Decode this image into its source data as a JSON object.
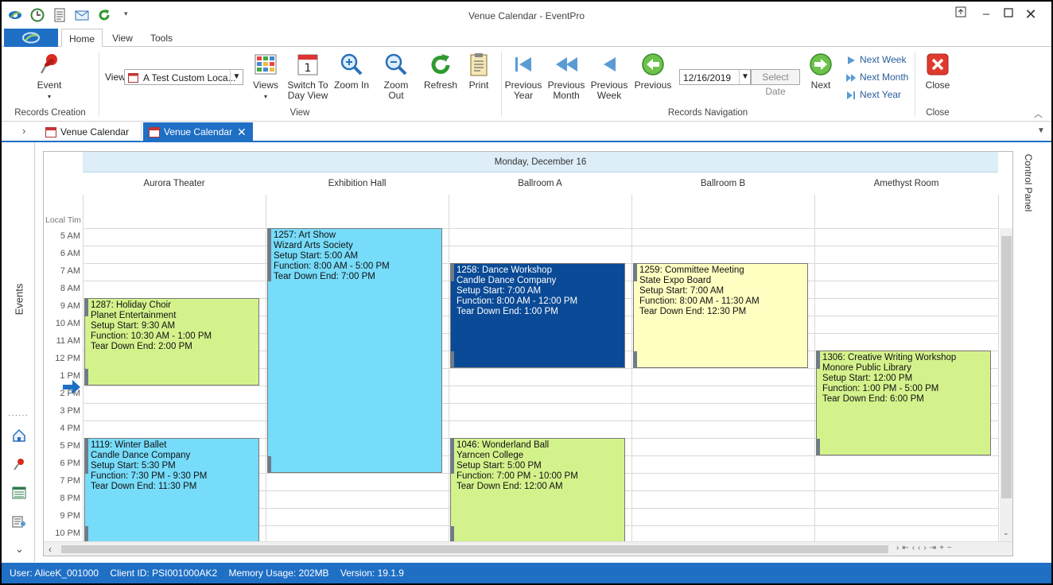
{
  "window": {
    "title": "Venue Calendar - EventPro"
  },
  "ribbon_tabs": [
    "Home",
    "View",
    "Tools"
  ],
  "ribbon": {
    "event": "Event",
    "view_label": "View",
    "view_select": "A Test Custom Loca...",
    "views": "Views",
    "switch_day_1": "Switch To",
    "switch_day_2": "Day View",
    "zoom_in": "Zoom In",
    "zoom_out": "Zoom Out",
    "refresh": "Refresh",
    "print": "Print",
    "prev_year_1": "Previous",
    "prev_year_2": "Year",
    "prev_month_1": "Previous",
    "prev_month_2": "Month",
    "prev_week_1": "Previous",
    "prev_week_2": "Week",
    "previous": "Previous",
    "date": "12/16/2019",
    "select_date": "Select Date",
    "next": "Next",
    "next_week": "Next Week",
    "next_month": "Next Month",
    "next_year": "Next Year",
    "close": "Close",
    "groups": {
      "records_creation": "Records Creation",
      "view": "View",
      "records_navigation": "Records Navigation",
      "close": "Close"
    }
  },
  "doc_tabs": [
    "Venue Calendar",
    "Venue Calendar"
  ],
  "left_panel": {
    "label": "Events"
  },
  "right_panel": {
    "label": "Control Panel"
  },
  "calendar": {
    "date_header": "Monday, December 16",
    "time_header": "Local Tim",
    "rooms": [
      "Aurora Theater",
      "Exhibition Hall",
      "Ballroom A",
      "Ballroom B",
      "Amethyst Room"
    ],
    "times": [
      "5 AM",
      "6 AM",
      "7 AM",
      "8 AM",
      "9 AM",
      "10 AM",
      "11 AM",
      "12 PM",
      "1 PM",
      "2 PM",
      "3 PM",
      "4 PM",
      "5 PM",
      "6 PM",
      "7 PM",
      "8 PM",
      "9 PM",
      "10 PM"
    ],
    "events": [
      {
        "lines": [
          "1287: Holiday Choir",
          "Planet Entertainment",
          "Setup Start: 9:30 AM",
          "Function: 10:30 AM - 1:00 PM",
          "Tear Down End: 2:00 PM"
        ],
        "color": "#d4f28c"
      },
      {
        "lines": [
          "1257: Art Show",
          "Wizard Arts Society",
          "Setup Start: 5:00 AM",
          "Function: 8:00 AM - 5:00 PM",
          "Tear Down End: 7:00 PM"
        ],
        "color": "#77dcfa"
      },
      {
        "lines": [
          "1258: Dance Workshop",
          "Candle Dance Company",
          "Setup Start: 7:00 AM",
          "Function: 8:00 AM - 12:00 PM",
          "Tear Down End: 1:00 PM"
        ],
        "color": "#0a4a96"
      },
      {
        "lines": [
          "1259: Committee Meeting",
          "State Expo Board",
          "Setup Start: 7:00 AM",
          "Function: 8:00 AM - 11:30 AM",
          "Tear Down End: 12:30 PM"
        ],
        "color": "#ffffc2"
      },
      {
        "lines": [
          "1306: Creative Writing Workshop",
          "Monore Public Library",
          "Setup Start: 12:00 PM",
          "Function: 1:00 PM - 5:00 PM",
          "Tear Down End: 6:00 PM"
        ],
        "color": "#d4f28c"
      },
      {
        "lines": [
          "1119: Winter Ballet",
          "Candle Dance Company",
          "Setup Start: 5:30 PM",
          "Function: 7:30 PM - 9:30 PM",
          "Tear Down End: 11:30 PM"
        ],
        "color": "#77dcfa"
      },
      {
        "lines": [
          "1046: Wonderland Ball",
          "Yarncen College",
          "Setup Start: 5:00 PM",
          "Function: 7:00 PM - 10:00 PM",
          "Tear Down End: 12:00 AM"
        ],
        "color": "#d4f28c"
      }
    ]
  },
  "status": {
    "user": "User: AliceK_001000",
    "client": "Client ID: PSI001000AK2",
    "memory": "Memory Usage: 202MB",
    "version": "Version: 19.1.9"
  }
}
